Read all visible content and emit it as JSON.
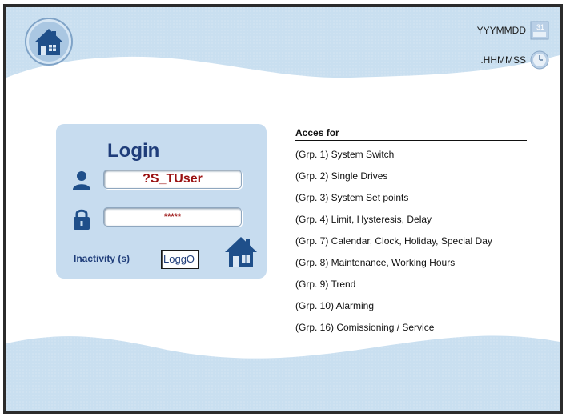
{
  "header": {
    "date_format": "YYYMMDD",
    "time_format": ".HHMMSS",
    "date_icon": "calendar-icon",
    "time_icon": "clock-icon",
    "home_icon": "home-icon"
  },
  "login": {
    "title": "Login",
    "username": "?S_TUser",
    "password": "*****",
    "inactivity_label": "Inactivity (s)",
    "logout_value": "LoggO",
    "user_icon": "user-icon",
    "lock_icon": "lock-icon",
    "logout_icon": "home-icon"
  },
  "access": {
    "title": "Acces for",
    "groups": [
      "(Grp. 1) System Switch",
      "(Grp. 2) Single Drives",
      "(Grp. 3) System Set points",
      "(Grp. 4) Limit, Hysteresis, Delay",
      "(Grp. 7) Calendar, Clock, Holiday, Special Day",
      "(Grp. 8) Maintenance, Working Hours",
      "(Grp. 9) Trend",
      "(Grp. 10) Alarming",
      "(Grp. 16) Comissioning / Service"
    ]
  },
  "colors": {
    "wave": "#c9dff0",
    "panel": "#c7dcef",
    "accent": "#1f3d7a",
    "value_text": "#9a1010"
  }
}
